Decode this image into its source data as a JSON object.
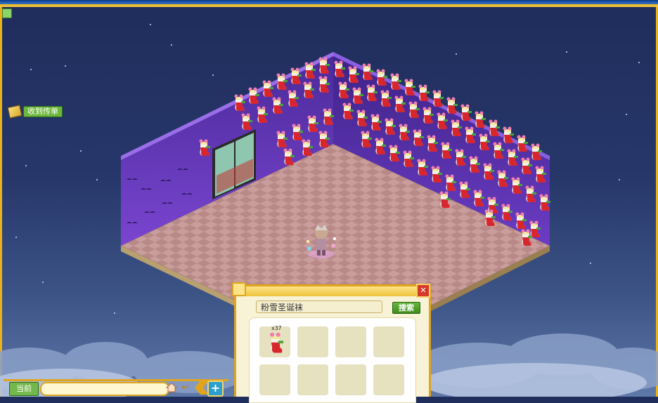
{
  "notification": {
    "label": "收到传单",
    "icon": "flyer-icon"
  },
  "inventory": {
    "search_value": "粉雪圣诞袜",
    "search_button": "搜索",
    "close_label": "✕",
    "slots": [
      {
        "item": "pink-snow-christmas-stocking",
        "count": "x37"
      },
      {
        "item": "",
        "count": ""
      },
      {
        "item": "",
        "count": ""
      },
      {
        "item": "",
        "count": ""
      },
      {
        "item": "",
        "count": ""
      },
      {
        "item": "",
        "count": ""
      },
      {
        "item": "",
        "count": ""
      },
      {
        "item": "",
        "count": ""
      }
    ]
  },
  "chat": {
    "tab_label": "当前",
    "input_value": "",
    "enter_icon": "↵",
    "plus_label": "+"
  },
  "colors": {
    "accent_gold": "#e0a51c",
    "button_green": "#4f9e2a",
    "wall_purple": "#6b39c6",
    "floor_pink": "#c79c9a"
  }
}
